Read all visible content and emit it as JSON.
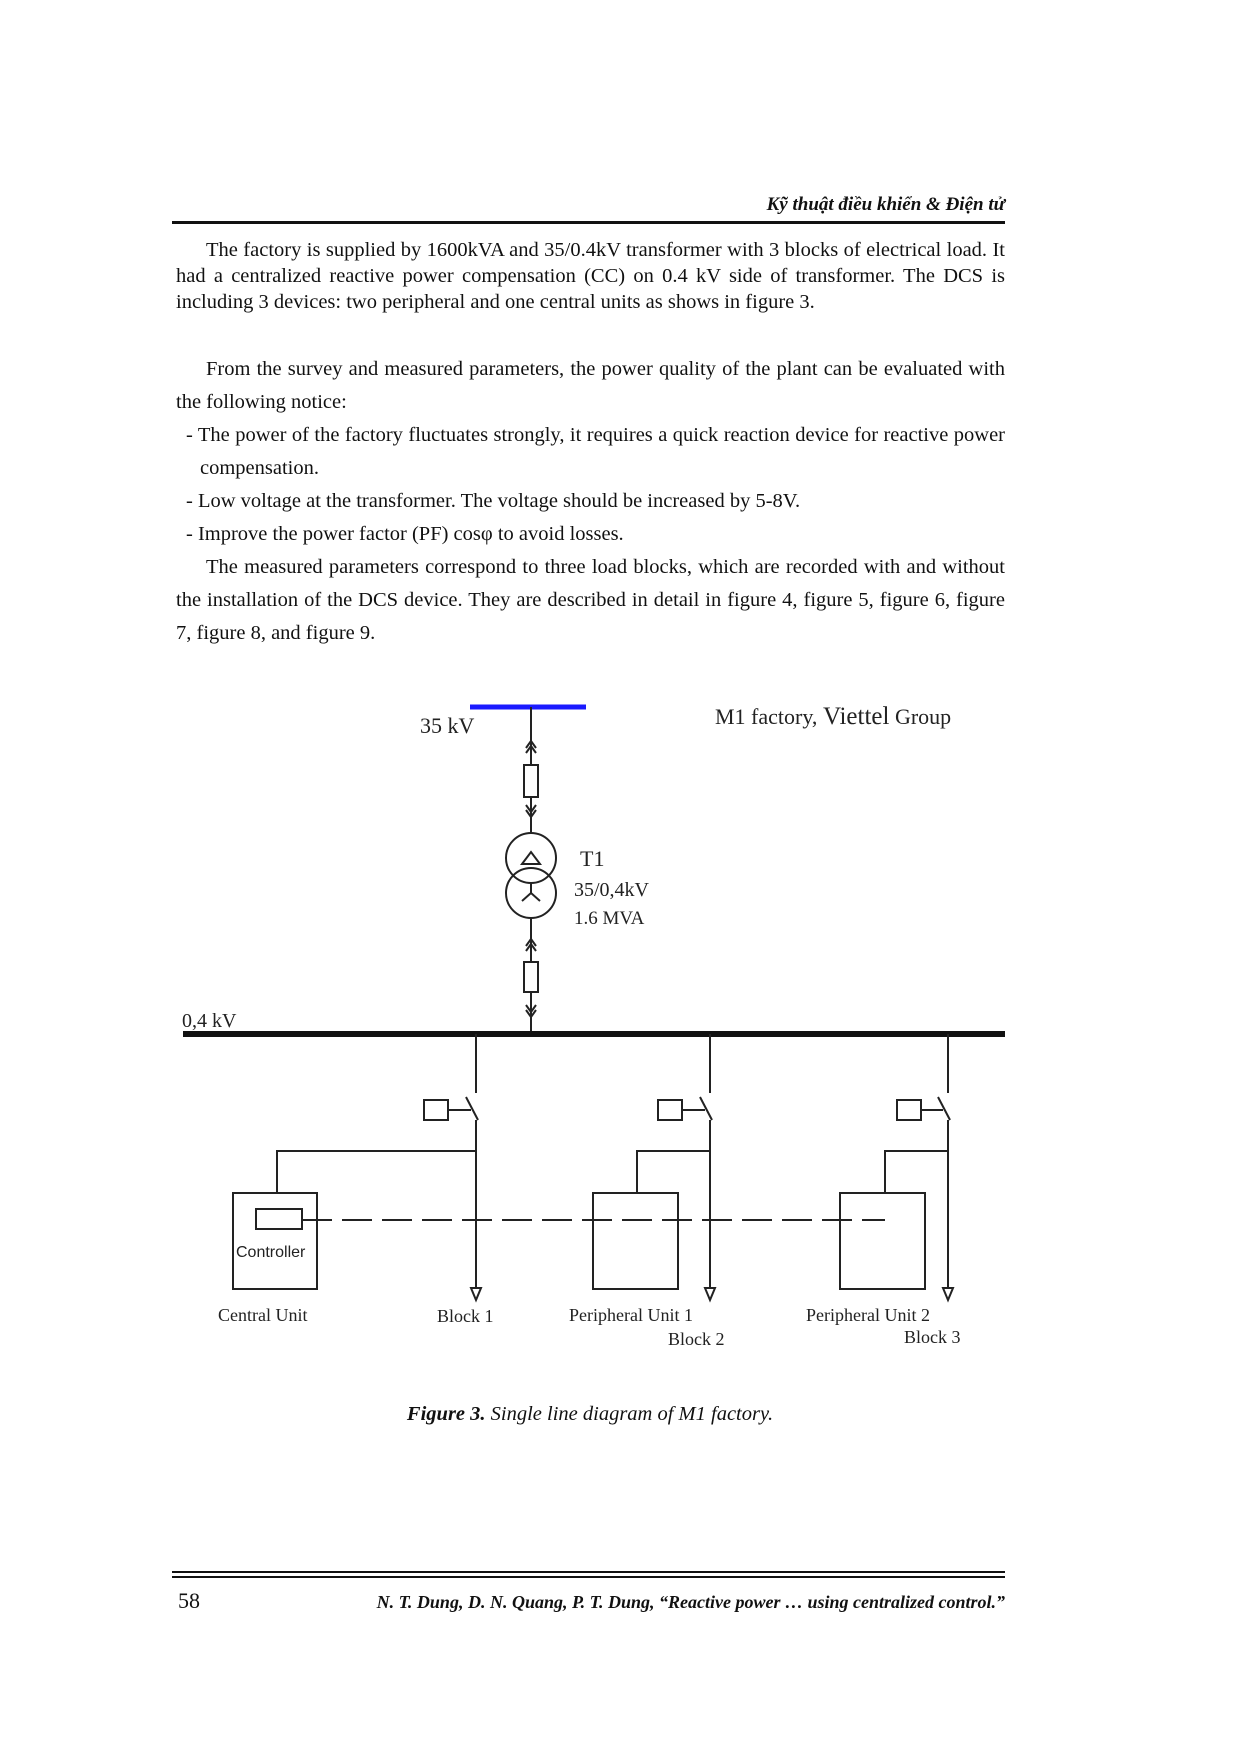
{
  "header": {
    "running_title": "Kỹ thuật điều khiển & Điện tử"
  },
  "body": {
    "paragraph1": "The factory is supplied by 1600kVA and 35/0.4kV transformer with 3 blocks of electrical load. It had a centralized reactive power compensation (CC) on 0.4 kV side of transformer. The DCS is including 3 devices: two peripheral and one central units as shows in figure 3.",
    "paragraph2": "From the survey and measured parameters, the power quality of the plant can be evaluated with the following notice:",
    "bullets": [
      "- The power of the factory fluctuates strongly, it requires a quick reaction device for reactive power compensation.",
      "- Low voltage at the transformer. The voltage should be increased by 5-8V.",
      "- Improve the power factor (PF) cosφ to avoid losses."
    ],
    "paragraph3": "The measured parameters correspond to three load blocks, which are recorded with and without the installation of the DCS device. They are described in detail in figure 4, figure 5, figure 6, figure 7, figure 8, and figure 9."
  },
  "figure": {
    "title_part1": "M1 factory, ",
    "title_part2": "Viettel",
    "title_part3": " Group",
    "hv_bus_label": "35 kV",
    "hv_bus_color": "#1a1aff",
    "lv_bus_label": "0,4 kV",
    "transformer": {
      "name": "T1",
      "ratio": "35/0,4kV",
      "rating": "1.6 MVA"
    },
    "controller_label": "Controller",
    "units": [
      {
        "label": "Central Unit"
      },
      {
        "label": "Peripheral Unit 1"
      },
      {
        "label": "Peripheral Unit 2"
      }
    ],
    "blocks": [
      {
        "label": "Block 1"
      },
      {
        "label": "Block 2"
      },
      {
        "label": "Block 3"
      }
    ],
    "caption_bold": "Figure 3.",
    "caption_text": " Single line diagram of M1 factory."
  },
  "footer": {
    "page_number": "58",
    "citation": "N. T. Dung, D. N. Quang, P. T. Dung, “Reactive power … using centralized control.”"
  }
}
